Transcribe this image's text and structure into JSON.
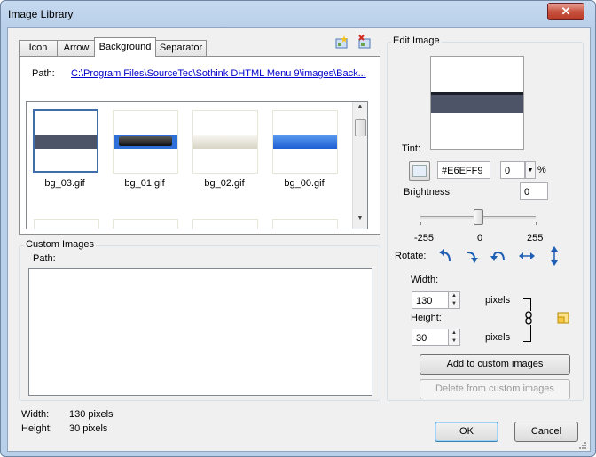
{
  "window": {
    "title": "Image Library",
    "close_glyph": "✕"
  },
  "tabs": [
    "Icon",
    "Arrow",
    "Background",
    "Separator"
  ],
  "library": {
    "path_label": "Path:",
    "path_value": "C:\\Program Files\\SourceTec\\Sothink DHTML Menu 9\\images\\Back...",
    "thumbs": [
      "bg_03.gif",
      "bg_01.gif",
      "bg_02.gif",
      "bg_00.gif"
    ]
  },
  "custom": {
    "group_label": "Custom Images",
    "path_label": "Path:"
  },
  "info": {
    "width_label": "Width:",
    "width_value": "130 pixels",
    "height_label": "Height:",
    "height_value": "30 pixels"
  },
  "edit": {
    "group_label": "Edit Image",
    "tint_label": "Tint:",
    "tint_value": "#E6EFF9",
    "tint_percent": "0",
    "percent_sign": "%",
    "brightness_label": "Brightness:",
    "brightness_value": "0",
    "slider_min": "-255",
    "slider_mid": "0",
    "slider_max": "255",
    "slider_fraction": 0.5,
    "rotate_label": "Rotate:",
    "width_label": "Width:",
    "width_value": "130",
    "height_label": "Height:",
    "height_value": "30",
    "pixels_label": "pixels",
    "add_button": "Add to custom images",
    "delete_button": "Delete from custom images"
  },
  "buttons": {
    "ok": "OK",
    "cancel": "Cancel"
  },
  "colors": {
    "selected_border": "#3f6ea8",
    "link": "#0000cc",
    "dark_bar": "#4e5468",
    "blue_bar": "#2e6fd8"
  }
}
